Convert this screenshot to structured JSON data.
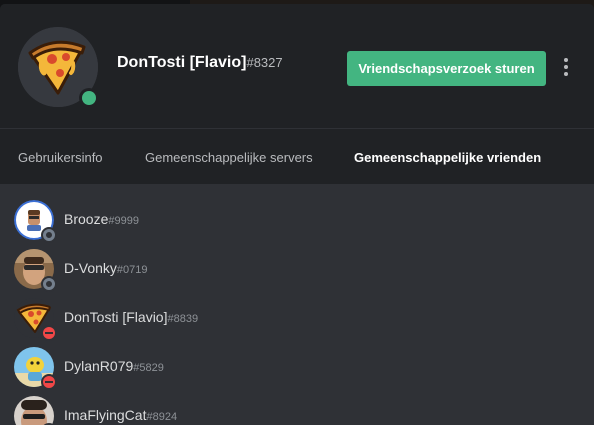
{
  "profile": {
    "username": "DonTosti [Flavio]",
    "discriminator": "#8327",
    "status": "online",
    "avatar_icon": "pizza-slice-icon",
    "friend_request_label": "Vriendschapsverzoek sturen"
  },
  "tabs": [
    {
      "label": "Gebruikersinfo",
      "active": false
    },
    {
      "label": "Gemeenschappelijke servers",
      "active": false
    },
    {
      "label": "Gemeenschappelijke vrienden",
      "active": true
    }
  ],
  "friends": [
    {
      "name": "Brooze",
      "discriminator": "#9999",
      "status": "offline"
    },
    {
      "name": "D-Vonky",
      "discriminator": "#0719",
      "status": "offline"
    },
    {
      "name": "DonTosti [Flavio]",
      "discriminator": "#8839",
      "status": "dnd"
    },
    {
      "name": "DylanR079",
      "discriminator": "#5829",
      "status": "dnd"
    },
    {
      "name": "ImaFlyingCat",
      "discriminator": "#8924",
      "status": "dnd"
    }
  ],
  "colors": {
    "online": "#43b581",
    "dnd": "#f04747",
    "offline": "#747f8d",
    "button": "#43b581",
    "header_bg": "#202225",
    "list_bg": "#2f3136"
  }
}
